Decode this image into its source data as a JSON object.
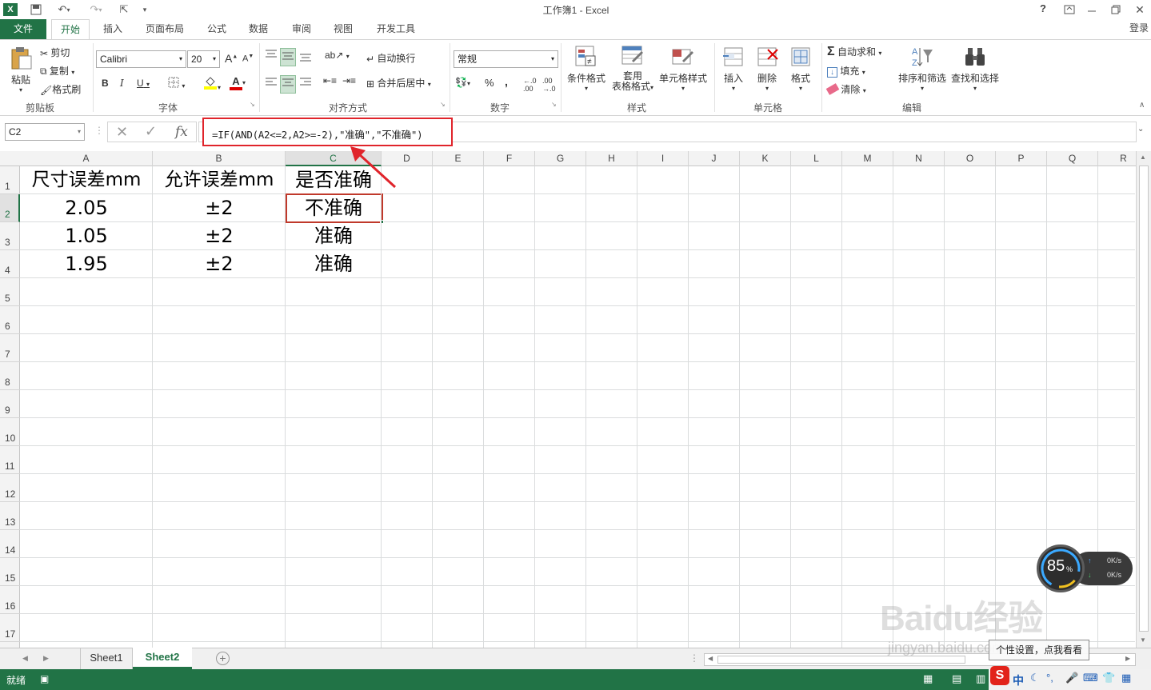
{
  "window": {
    "title": "工作簿1 - Excel",
    "help": "?",
    "login": "登录"
  },
  "tabs": [
    "文件",
    "开始",
    "插入",
    "页面布局",
    "公式",
    "数据",
    "审阅",
    "视图",
    "开发工具"
  ],
  "ribbon": {
    "clipboard": {
      "paste": "粘贴",
      "cut": "剪切",
      "copy": "复制",
      "format_painter": "格式刷",
      "label": "剪贴板"
    },
    "font": {
      "name": "Calibri",
      "size": "20",
      "bold": "B",
      "italic": "I",
      "underline": "U",
      "font_color_glyph": "A",
      "grow": "A",
      "shrink": "A",
      "label": "字体"
    },
    "alignment": {
      "wrap": "自动换行",
      "merge": "合并后居中",
      "label": "对齐方式"
    },
    "number": {
      "format": "常规",
      "percent": "%",
      "comma": ",",
      "label": "数字"
    },
    "styles": {
      "conditional": "条件格式",
      "table_1": "套用",
      "table_2": "表格格式",
      "cell_styles": "单元格样式",
      "label": "样式"
    },
    "cells": {
      "insert": "插入",
      "delete": "删除",
      "format": "格式",
      "label": "单元格"
    },
    "editing": {
      "autosum": "自动求和",
      "fill": "填充",
      "clear": "清除",
      "sort": "排序和筛选",
      "find": "查找和选择",
      "label": "编辑"
    }
  },
  "formula_bar": {
    "name_box": "C2",
    "fx": "fx",
    "formula": "=IF(AND(A2<=2,A2>=-2),\"准确\",\"不准确\")"
  },
  "columns": [
    "A",
    "B",
    "C",
    "D",
    "E",
    "F",
    "G",
    "H",
    "I",
    "J",
    "K",
    "L",
    "M",
    "N",
    "O",
    "P",
    "Q",
    "R"
  ],
  "rows": [
    "1",
    "2",
    "3",
    "4",
    "5",
    "6",
    "7",
    "8",
    "9",
    "10",
    "11",
    "12",
    "13",
    "14",
    "15",
    "16",
    "17"
  ],
  "cells": {
    "A1": "尺寸误差mm",
    "B1": "允许误差mm",
    "C1": "是否准确",
    "A2": "2.05",
    "B2": "±2",
    "C2": "不准确",
    "A3": "1.05",
    "B3": "±2",
    "C3": "准确",
    "A4": "1.95",
    "B4": "±2",
    "C4": "准确"
  },
  "sheets": [
    "Sheet1",
    "Sheet2"
  ],
  "active_sheet": "Sheet2",
  "status": {
    "ready": "就绪"
  },
  "overlay": {
    "cpu": "85",
    "cpu_unit": "%",
    "up": "0K/s",
    "down": "0K/s",
    "tooltip": "个性设置，点我看看",
    "watermark": "Baidu经验",
    "watermark_url": "jingyan.baidu.com",
    "ime": "中"
  },
  "colors": {
    "excel_green": "#217346",
    "annotation_red": "#e0242b"
  }
}
